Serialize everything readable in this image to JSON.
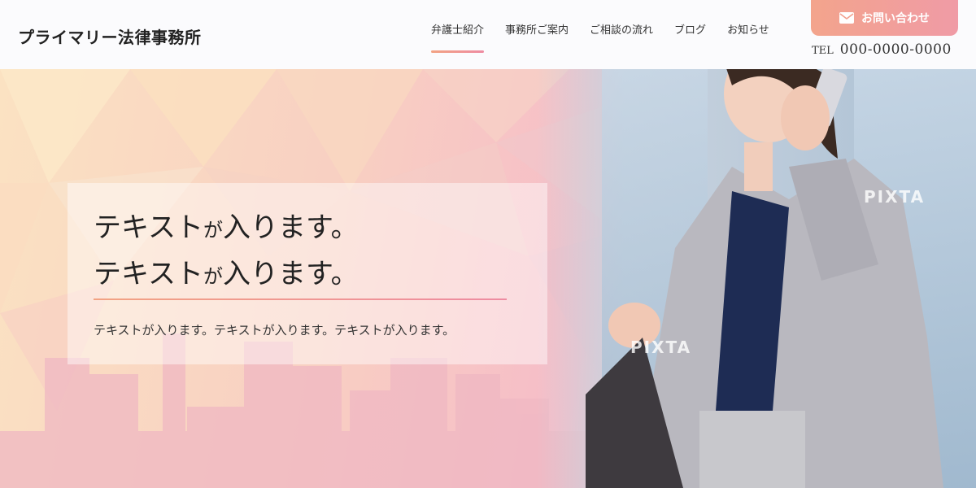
{
  "header": {
    "logo": "プライマリー法律事務所",
    "nav": [
      {
        "label": "弁護士紹介",
        "active": true
      },
      {
        "label": "事務所ご案内",
        "active": false
      },
      {
        "label": "ご相談の流れ",
        "active": false
      },
      {
        "label": "ブログ",
        "active": false
      },
      {
        "label": "お知らせ",
        "active": false
      }
    ],
    "contact_button": "お問い合わせ",
    "tel_label": "TEL",
    "tel_number": "000-0000-0000"
  },
  "hero": {
    "headline_line1_main": "テキスト",
    "headline_line1_small": "が",
    "headline_line1_rest": "入ります。",
    "headline_line2_main": "テキスト",
    "headline_line2_small": "が",
    "headline_line2_rest": "入ります。",
    "subtext": "テキストが入ります。テキストが入ります。テキストが入ります。",
    "watermark_1": "PIXTA",
    "watermark_2": "PIXTA"
  },
  "colors": {
    "accent_start": "#f2a383",
    "accent_end": "#ee8ca2"
  },
  "icons": {
    "mail": "mail-icon"
  }
}
